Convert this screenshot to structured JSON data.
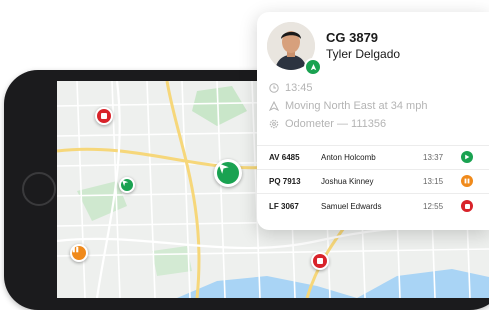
{
  "vehicle": {
    "id": "CG 3879",
    "driver": "Tyler Delgado",
    "time": "13:45",
    "heading": "Moving North East at 34 mph",
    "odometer": "Odometer — 111356"
  },
  "fleet": [
    {
      "id": "AV 6485",
      "driver": "Anton Holcomb",
      "time": "13:37",
      "status": "moving"
    },
    {
      "id": "PQ 7913",
      "driver": "Joshua Kinney",
      "time": "13:15",
      "status": "paused"
    },
    {
      "id": "LF 3067",
      "driver": "Samuel Edwards",
      "time": "12:55",
      "status": "stopped"
    }
  ],
  "colors": {
    "moving": "#1aa251",
    "paused": "#f08a1b",
    "stopped": "#d8232a"
  },
  "icons": [
    "clock-icon",
    "navigation-arrow-icon",
    "gear-icon",
    "play-icon",
    "pause-icon",
    "stop-icon"
  ]
}
